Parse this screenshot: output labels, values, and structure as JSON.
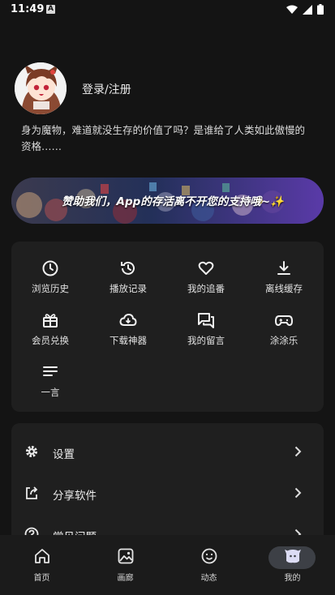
{
  "status_bar": {
    "time": "11:49",
    "notif_badge": "A"
  },
  "profile": {
    "login_label": "登录/注册"
  },
  "bio": "身为魔物，难道就没生存的价值了吗？是谁给了人类如此傲慢的资格……",
  "banner": {
    "text": "赞助我们，App的存活离不开您的支持哦~✨"
  },
  "grid": [
    {
      "label": "浏览历史",
      "icon": "clock-icon"
    },
    {
      "label": "播放记录",
      "icon": "history-icon"
    },
    {
      "label": "我的追番",
      "icon": "heart-icon"
    },
    {
      "label": "离线缓存",
      "icon": "download-icon"
    },
    {
      "label": "会员兑换",
      "icon": "gift-icon"
    },
    {
      "label": "下载神器",
      "icon": "cloud-download-icon"
    },
    {
      "label": "我的留言",
      "icon": "chat-icon"
    },
    {
      "label": "涂涂乐",
      "icon": "gamepad-icon"
    },
    {
      "label": "一言",
      "icon": "lines-icon"
    }
  ],
  "settings": [
    {
      "label": "设置",
      "icon": "gear-icon"
    },
    {
      "label": "分享软件",
      "icon": "share-icon"
    },
    {
      "label": "常见问题",
      "icon": "help-icon"
    }
  ],
  "tabs": [
    {
      "label": "首页",
      "icon": "home-icon"
    },
    {
      "label": "画廊",
      "icon": "gallery-icon"
    },
    {
      "label": "动态",
      "icon": "smile-icon"
    },
    {
      "label": "我的",
      "icon": "profile-icon",
      "active": true
    }
  ],
  "colors": {
    "background": "#141414",
    "card": "#1f1f1f",
    "tab_active_pill": "#3d4046",
    "banner": "#2c3760"
  }
}
